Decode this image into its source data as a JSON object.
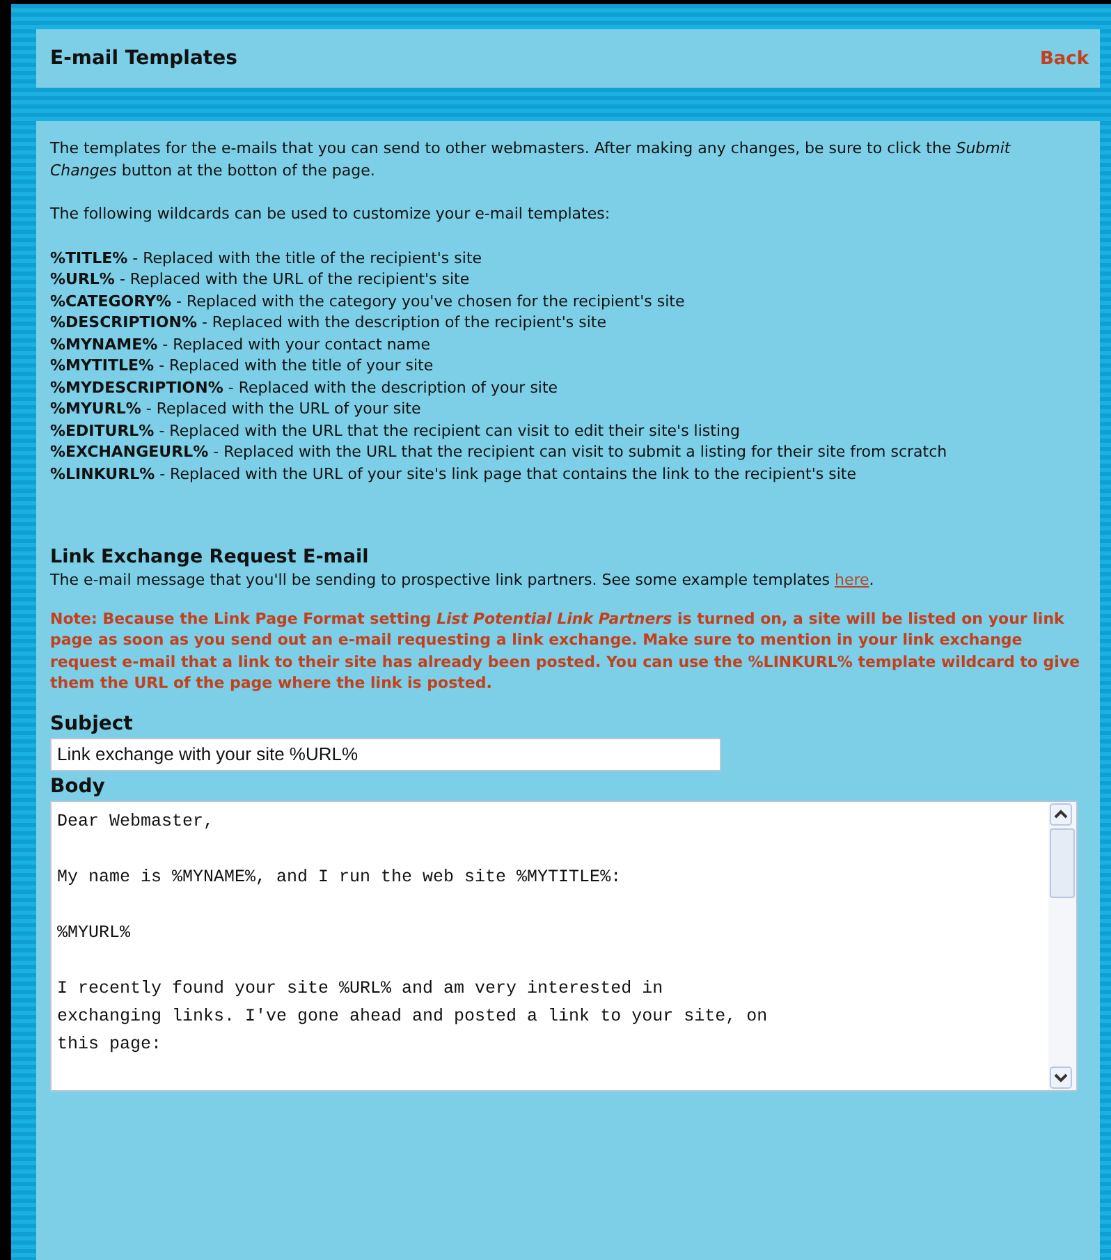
{
  "header": {
    "title": "E-mail Templates",
    "back_link": "Back"
  },
  "intro": "The templates for the e-mails that you can send to other webmasters. After making any changes, be sure to click the *Submit Changes* button at the botton of the page.",
  "wildcards_intro": "The following wildcards can be used to customize your e-mail templates:",
  "wildcards": [
    "**%TITLE%** - Replaced with the title of the recipient's site",
    "**%URL%** - Replaced with the URL of the recipient's site",
    "**%CATEGORY%** - Replaced with the category you've chosen for the recipient's site",
    "**%DESCRIPTION%** - Replaced with the description of the recipient's site",
    "**%MYNAME%** - Replaced with your contact name",
    "**%MYTITLE%** - Replaced with the title of your site",
    "**%MYDESCRIPTION%** - Replaced with the description of your site",
    "**%MYURL%** - Replaced with the URL of your site",
    "**%EDITURL%** - Replaced with the URL that the recipient can visit to edit their site's listing",
    "**%EXCHANGEURL%** - Replaced with the URL that the recipient can visit to submit a listing for their site from scratch",
    "**%LINKURL%** - Replaced with the URL of your site's link page that contains the link to the recipient's site"
  ],
  "section": {
    "title": "Link Exchange Request E-mail",
    "description": "The e-mail message that you'll be sending to prospective link partners. See some example templates",
    "link": "here",
    "after_link": ".",
    "note": "Note: Because the Link Page Format setting *List Potential Link Partners* is turned on, a site will be listed on your link page as soon as you send out an e-mail requesting a link exchange. Make sure to mention in your link exchange request e-mail that a link to their site has already been posted. You can use the %LINKURL% template wildcard to give them the URL of the page where the link is posted."
  },
  "subject": {
    "label": "Subject",
    "value": "Link exchange with your site %URL%"
  },
  "body": {
    "label": "Body",
    "value": "Dear Webmaster,\n\nMy name is %MYNAME%, and I run the web site %MYTITLE%:\n\n%MYURL%\n\nI recently found your site %URL% and am very interested in\nexchanging links. I've gone ahead and posted a link to your site, on\nthis page:"
  }
}
